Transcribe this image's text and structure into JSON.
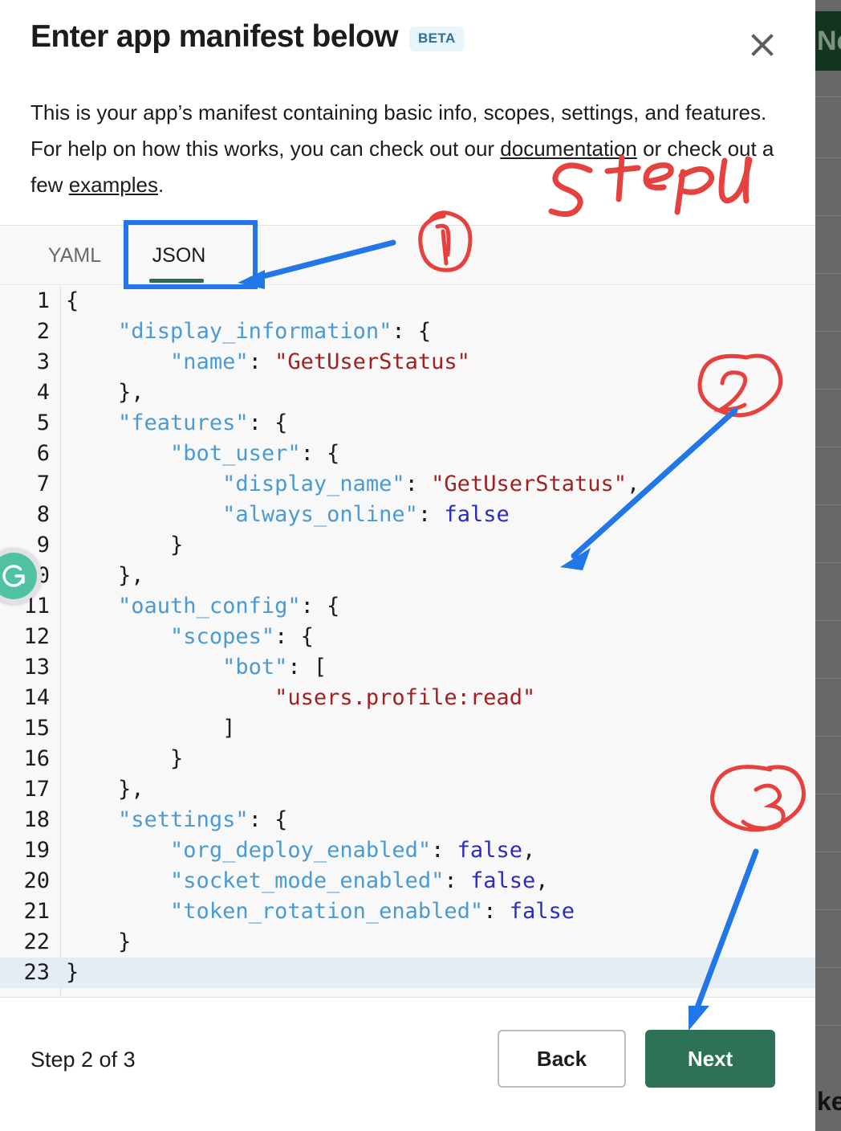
{
  "modal": {
    "title": "Enter app manifest below",
    "beta_badge": "BETA",
    "close_icon": "close-icon",
    "description_pre": "This is your app’s manifest containing basic info, scopes, settings, and features. For help on how this works, you can check out our ",
    "description_link1": "documentation",
    "description_mid": " or check out a few ",
    "description_link2": "examples",
    "description_post": "."
  },
  "tabs": {
    "yaml": "YAML",
    "json": "JSON",
    "active": "JSON",
    "accent_color": "#2e6b4f"
  },
  "editor": {
    "language": "json",
    "active_line": 23,
    "lines": [
      {
        "n": "1",
        "tokens": [
          {
            "t": "{",
            "c": "punc"
          }
        ]
      },
      {
        "n": "2",
        "tokens": [
          {
            "t": "    ",
            "c": "punc"
          },
          {
            "t": "\"display_information\"",
            "c": "key"
          },
          {
            "t": ": {",
            "c": "punc"
          }
        ]
      },
      {
        "n": "3",
        "tokens": [
          {
            "t": "        ",
            "c": "punc"
          },
          {
            "t": "\"name\"",
            "c": "key"
          },
          {
            "t": ": ",
            "c": "punc"
          },
          {
            "t": "\"GetUserStatus\"",
            "c": "str"
          }
        ]
      },
      {
        "n": "4",
        "tokens": [
          {
            "t": "    },",
            "c": "punc"
          }
        ]
      },
      {
        "n": "5",
        "tokens": [
          {
            "t": "    ",
            "c": "punc"
          },
          {
            "t": "\"features\"",
            "c": "key"
          },
          {
            "t": ": {",
            "c": "punc"
          }
        ]
      },
      {
        "n": "6",
        "tokens": [
          {
            "t": "        ",
            "c": "punc"
          },
          {
            "t": "\"bot_user\"",
            "c": "key"
          },
          {
            "t": ": {",
            "c": "punc"
          }
        ]
      },
      {
        "n": "7",
        "tokens": [
          {
            "t": "            ",
            "c": "punc"
          },
          {
            "t": "\"display_name\"",
            "c": "key"
          },
          {
            "t": ": ",
            "c": "punc"
          },
          {
            "t": "\"GetUserStatus\"",
            "c": "str"
          },
          {
            "t": ",",
            "c": "punc"
          }
        ]
      },
      {
        "n": "8",
        "tokens": [
          {
            "t": "            ",
            "c": "punc"
          },
          {
            "t": "\"always_online\"",
            "c": "key"
          },
          {
            "t": ": ",
            "c": "punc"
          },
          {
            "t": "false",
            "c": "bool"
          }
        ]
      },
      {
        "n": "9",
        "tokens": [
          {
            "t": "        }",
            "c": "punc"
          }
        ]
      },
      {
        "n": "10",
        "tokens": [
          {
            "t": "    },",
            "c": "punc"
          }
        ]
      },
      {
        "n": "11",
        "tokens": [
          {
            "t": "    ",
            "c": "punc"
          },
          {
            "t": "\"oauth_config\"",
            "c": "key"
          },
          {
            "t": ": {",
            "c": "punc"
          }
        ]
      },
      {
        "n": "12",
        "tokens": [
          {
            "t": "        ",
            "c": "punc"
          },
          {
            "t": "\"scopes\"",
            "c": "key"
          },
          {
            "t": ": {",
            "c": "punc"
          }
        ]
      },
      {
        "n": "13",
        "tokens": [
          {
            "t": "            ",
            "c": "punc"
          },
          {
            "t": "\"bot\"",
            "c": "key"
          },
          {
            "t": ": [",
            "c": "punc"
          }
        ]
      },
      {
        "n": "14",
        "tokens": [
          {
            "t": "                ",
            "c": "punc"
          },
          {
            "t": "\"users.profile:read\"",
            "c": "str"
          }
        ]
      },
      {
        "n": "15",
        "tokens": [
          {
            "t": "            ]",
            "c": "punc"
          }
        ]
      },
      {
        "n": "16",
        "tokens": [
          {
            "t": "        }",
            "c": "punc"
          }
        ]
      },
      {
        "n": "17",
        "tokens": [
          {
            "t": "    },",
            "c": "punc"
          }
        ]
      },
      {
        "n": "18",
        "tokens": [
          {
            "t": "    ",
            "c": "punc"
          },
          {
            "t": "\"settings\"",
            "c": "key"
          },
          {
            "t": ": {",
            "c": "punc"
          }
        ]
      },
      {
        "n": "19",
        "tokens": [
          {
            "t": "        ",
            "c": "punc"
          },
          {
            "t": "\"org_deploy_enabled\"",
            "c": "key"
          },
          {
            "t": ": ",
            "c": "punc"
          },
          {
            "t": "false",
            "c": "bool"
          },
          {
            "t": ",",
            "c": "punc"
          }
        ]
      },
      {
        "n": "20",
        "tokens": [
          {
            "t": "        ",
            "c": "punc"
          },
          {
            "t": "\"socket_mode_enabled\"",
            "c": "key"
          },
          {
            "t": ": ",
            "c": "punc"
          },
          {
            "t": "false",
            "c": "bool"
          },
          {
            "t": ",",
            "c": "punc"
          }
        ]
      },
      {
        "n": "21",
        "tokens": [
          {
            "t": "        ",
            "c": "punc"
          },
          {
            "t": "\"token_rotation_enabled\"",
            "c": "key"
          },
          {
            "t": ": ",
            "c": "punc"
          },
          {
            "t": "false",
            "c": "bool"
          }
        ]
      },
      {
        "n": "22",
        "tokens": [
          {
            "t": "    }",
            "c": "punc"
          }
        ]
      },
      {
        "n": "23",
        "tokens": [
          {
            "t": "}",
            "c": "punc"
          }
        ]
      }
    ]
  },
  "footer": {
    "step_text": "Step 2 of 3",
    "back_label": "Back",
    "next_label": "Next",
    "next_color": "#2e7256"
  },
  "background_page": {
    "top_button_text": "Ne",
    "bottom_text": "ke"
  },
  "extension": {
    "name": "grammarly-badge",
    "letter": "G",
    "color": "#4fc3a1"
  },
  "annotations": {
    "ink_color": "#e03b3b",
    "arrow_color": "#1a73e8",
    "handwriting": "Step 4",
    "markers": [
      {
        "label": "1",
        "points_to": "json-tab"
      },
      {
        "label": "2",
        "points_to": "editor-body"
      },
      {
        "label": "3",
        "points_to": "next-button"
      }
    ]
  }
}
